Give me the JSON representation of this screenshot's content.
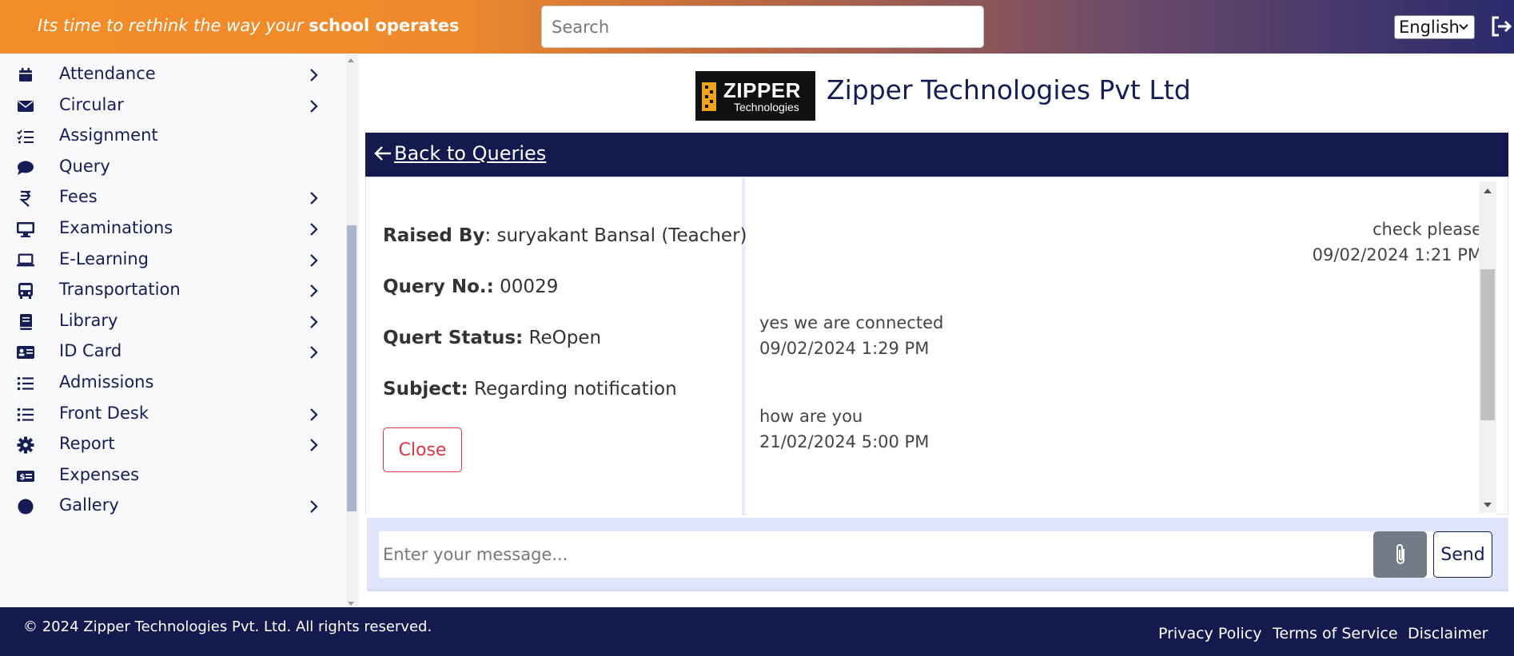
{
  "header": {
    "tagline_prefix": "Its time to rethink the way your ",
    "tagline_bold": "school operates",
    "search_placeholder": "Search",
    "language": "English"
  },
  "sidebar": {
    "items": [
      {
        "label": "Attendance",
        "icon": "calendar-icon",
        "has_submenu": true
      },
      {
        "label": "Circular",
        "icon": "envelope-icon",
        "has_submenu": true
      },
      {
        "label": "Assignment",
        "icon": "checklist-icon",
        "has_submenu": false
      },
      {
        "label": "Query",
        "icon": "chat-bubble-icon",
        "has_submenu": false
      },
      {
        "label": "Fees",
        "icon": "rupee-icon",
        "has_submenu": true
      },
      {
        "label": "Examinations",
        "icon": "monitor-icon",
        "has_submenu": true
      },
      {
        "label": "E-Learning",
        "icon": "laptop-icon",
        "has_submenu": true
      },
      {
        "label": "Transportation",
        "icon": "bus-icon",
        "has_submenu": true
      },
      {
        "label": "Library",
        "icon": "book-icon",
        "has_submenu": true
      },
      {
        "label": "ID Card",
        "icon": "id-card-icon",
        "has_submenu": true
      },
      {
        "label": "Admissions",
        "icon": "list-icon",
        "has_submenu": false
      },
      {
        "label": "Front Desk",
        "icon": "list-icon",
        "has_submenu": true
      },
      {
        "label": "Report",
        "icon": "gear-icon",
        "has_submenu": true
      },
      {
        "label": "Expenses",
        "icon": "money-icon",
        "has_submenu": false
      },
      {
        "label": "Gallery",
        "icon": "circle-icon",
        "has_submenu": true
      }
    ]
  },
  "brand": {
    "logo_text": "ZIPPER",
    "logo_subtext": "Technologies",
    "company_name": "Zipper Technologies Pvt Ltd"
  },
  "query": {
    "back_label": "Back to Queries",
    "raised_by_label": "Raised By",
    "raised_by_value": ": suryakant Bansal (Teacher)",
    "query_no_label": "Query No.:",
    "query_no_value": " 00029",
    "status_label": "Quert Status:",
    "status_value": " ReOpen",
    "subject_label": "Subject:",
    "subject_value": " Regarding notification",
    "close_label": "Close"
  },
  "messages": [
    {
      "text": "check please",
      "time": "09/02/2024 1:21 PM",
      "side": "right"
    },
    {
      "text": "yes we are connected",
      "time": "09/02/2024 1:29 PM",
      "side": "left"
    },
    {
      "text": "how are you",
      "time": "21/02/2024 5:00 PM",
      "side": "left"
    }
  ],
  "composer": {
    "placeholder": "Enter your message...",
    "send_label": "Send"
  },
  "footer": {
    "copyright": "© 2024 Zipper Technologies Pvt. Ltd. All rights reserved.",
    "links": [
      "Privacy Policy",
      "Terms of Service",
      "Disclaimer"
    ]
  },
  "colors": {
    "navy": "#141a4e",
    "accent_orange": "#f28c28",
    "danger": "#dc3545"
  }
}
